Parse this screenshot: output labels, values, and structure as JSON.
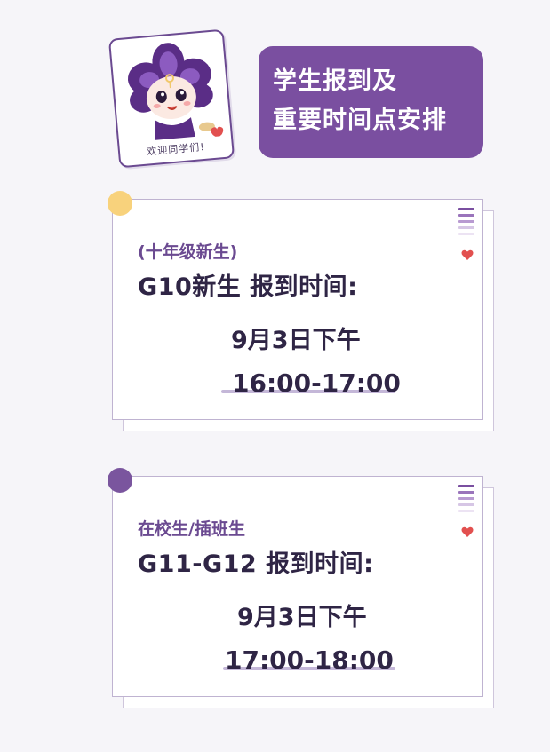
{
  "header": {
    "mascot_caption": "欢迎同学们!",
    "title_line1": "学生报到及",
    "title_line2": "重要时间点安排"
  },
  "cards": [
    {
      "tag": "(十年级新生)",
      "heading": "G10新生 报到时间:",
      "date": "9月3日下午",
      "time": "16:00-17:00",
      "dot_color": "#f8d27c"
    },
    {
      "tag": "在校生/插班生",
      "heading": "G11-G12 报到时间:",
      "date": "9月3日下午",
      "time": "17:00-18:00",
      "dot_color": "#7a559e"
    }
  ],
  "colors": {
    "brand_purple": "#7a4fa0",
    "text_dark": "#2f2545",
    "heart_red": "#e2504f"
  },
  "icons": [
    "mascot-flower-icon",
    "heart-icon",
    "stripes-decoration-icon"
  ]
}
